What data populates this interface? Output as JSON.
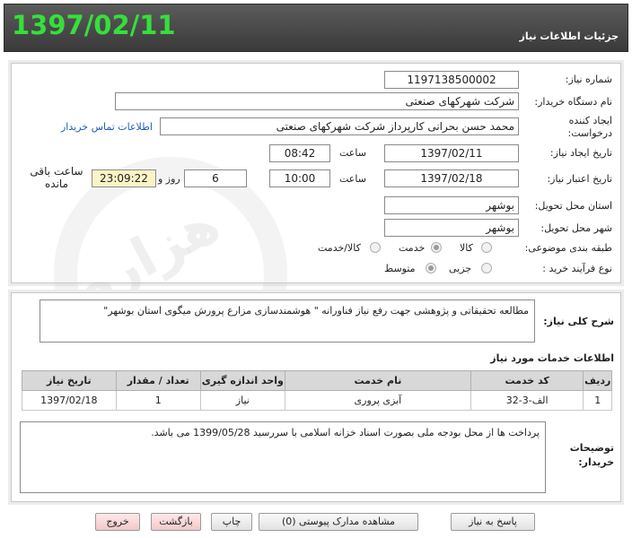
{
  "header": {
    "date": "1397/02/11",
    "title": "جزئیات اطلاعات نیاز"
  },
  "form": {
    "need_number_label": "شماره نیاز:",
    "need_number": "1197138500002",
    "buyer_org_label": "نام دستگاه خریدار:",
    "buyer_org": "شرکت شهرکهای صنعتی",
    "creator_label": "ایجاد کننده درخواست:",
    "creator": "محمد حسن بحرانی کارپرداز شرکت شهرکهای صنعتی",
    "buyer_contact_link": "اطلاعات تماس خریدار",
    "created_date_label": "تاریخ ایجاد نیاز:",
    "created_date": "1397/02/11",
    "time_label": "ساعت",
    "created_time": "08:42",
    "validity_label": "تاریخ اعتبار نیاز:",
    "validity_date": "1397/02/18",
    "validity_time": "10:00",
    "days_value": "6",
    "days_label": "روز و",
    "remaining_time": "23:09:22",
    "remaining_label": "ساعت باقی مانده",
    "province_label": "استان محل تحویل:",
    "province": "بوشهر",
    "city_label": "شهر محل تحویل:",
    "city": "بوشهر",
    "category_label": "طبقه بندی موضوعی:",
    "category_options": [
      "کالا",
      "خدمت",
      "کالا/خدمت"
    ],
    "category_selected": "خدمت",
    "process_label": "نوع فرآیند خرید :",
    "process_options": [
      "جزیی",
      "متوسط"
    ],
    "process_selected": "متوسط"
  },
  "description": {
    "label": "شرح کلی نیاز:",
    "text": "مطالعه تحقیقاتی و پژوهشی جهت رفع نیاز فناورانه \" هوشمندسازی مزارع پرورش میگوی استان بوشهر\""
  },
  "services": {
    "title": "اطلاعات خدمات مورد نیاز",
    "columns": [
      "ردیف",
      "کد خدمت",
      "نام خدمت",
      "واحد اندازه گیری",
      "تعداد / مقدار",
      "تاریخ نیاز"
    ],
    "rows": [
      [
        "1",
        "الف-3-32",
        "آبزی پروری",
        "نیاز",
        "1",
        "1397/02/18"
      ]
    ]
  },
  "buyer_notes": {
    "label": "توضیحات خریدار:",
    "text": "پرداخت ها از محل بودجه ملی بصورت اسناد خزانه اسلامی با سررسید 1399/05/28 می باشد."
  },
  "buttons": {
    "reply": "پاسخ به نیاز",
    "attachments": "مشاهده مدارک پیوستی (0)",
    "print": "چاپ",
    "back": "بازگشت",
    "exit": "خروج"
  }
}
